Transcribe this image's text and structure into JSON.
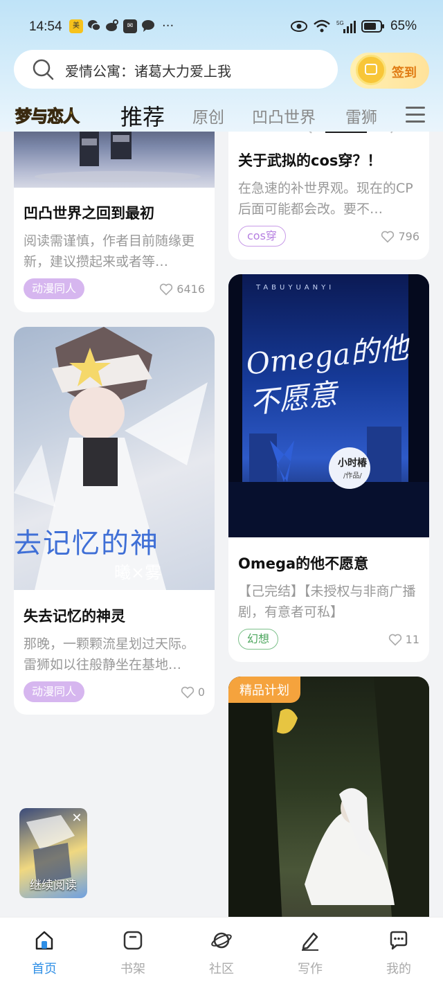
{
  "status_bar": {
    "time": "14:54",
    "app_icons": [
      "meituan-icon",
      "wechat-icon",
      "weibo-icon",
      "mail-icon",
      "chat-icon"
    ],
    "dots": "···",
    "battery": "65%"
  },
  "search": {
    "text": "爱情公寓：诸葛大力爱上我"
  },
  "signin": {
    "label": "签到"
  },
  "logo": "梦与恋人",
  "tabs": [
    {
      "label": "推荐",
      "active": true
    },
    {
      "label": "原创",
      "active": false
    },
    {
      "label": "凹凸世界",
      "active": false
    },
    {
      "label": "雷狮",
      "active": false
    }
  ],
  "cards": [
    {
      "title": "凹凸世界之回到最初",
      "desc": "阅读需谨慎，作者目前随缘更新，建议攒起来或者等…",
      "tag": "动漫同人",
      "likes": "6416"
    },
    {
      "title": "关于武拟的cos穿？！",
      "desc": "在急速的补世界观。现在的CP后面可能都会改。要不…",
      "tag": "cos穿",
      "likes": "796"
    },
    {
      "title": "失去记忆的神灵",
      "desc": "那晚，一颗颗流星划过天际。雷狮如以往般静坐在基地…",
      "tag": "动漫同人",
      "likes": "0",
      "cover_text": "去记忆的神",
      "cover_sub": "曦×雾"
    },
    {
      "title": "Omega的他不愿意",
      "desc": "【己完结】【未授权与非商广播剧，有意者可私】",
      "tag": "幻想",
      "likes": "11",
      "cover_top": "TABUYUANYI",
      "cover_script": "Omega的他不愿意",
      "cover_author": "小时椿",
      "cover_author_sub": "/作品/"
    },
    {
      "badge": "精品计划"
    }
  ],
  "continue_reading": {
    "label": "继续阅读"
  },
  "bottom_nav": [
    {
      "label": "首页",
      "icon": "home-icon",
      "active": true
    },
    {
      "label": "书架",
      "icon": "bookshelf-icon",
      "active": false
    },
    {
      "label": "社区",
      "icon": "planet-icon",
      "active": false
    },
    {
      "label": "写作",
      "icon": "pen-icon",
      "active": false
    },
    {
      "label": "我的",
      "icon": "message-icon",
      "active": false
    }
  ],
  "colors": {
    "accent": "#2f8fe6",
    "tag_anime": "#d6b6ef",
    "tag_cos": "#b57fe0",
    "tag_fantasy": "#4da65e",
    "premium_badge": "#f5a33d",
    "signin_text": "#e07b13"
  }
}
